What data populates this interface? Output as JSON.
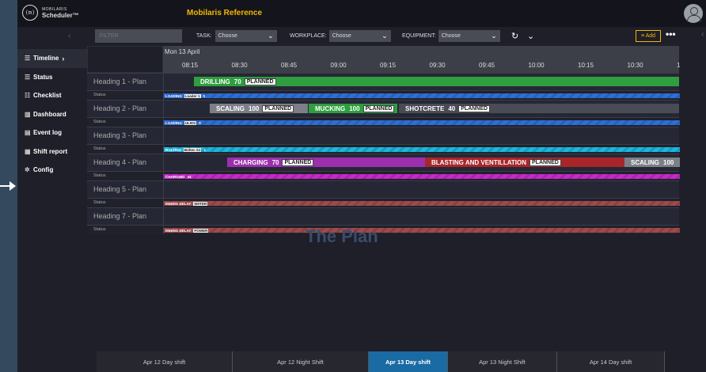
{
  "app": {
    "logo_line1": "MOBILARIS",
    "logo_line2": "Scheduler™",
    "logo_mark": "(m)",
    "title": "Mobilaris Reference"
  },
  "sidebar": {
    "items": [
      {
        "label": "Timeline",
        "icon": "timeline-icon",
        "glyph": "☰"
      },
      {
        "label": "Status",
        "icon": "list-icon",
        "glyph": "☰"
      },
      {
        "label": "Checklist",
        "icon": "checklist-icon",
        "glyph": "☷"
      },
      {
        "label": "Dashboard",
        "icon": "dashboard-icon",
        "glyph": "▥"
      },
      {
        "label": "Event log",
        "icon": "document-icon",
        "glyph": "▤"
      },
      {
        "label": "Shift report",
        "icon": "report-icon",
        "glyph": "▦"
      },
      {
        "label": "Config",
        "icon": "gear-icon",
        "glyph": "✲"
      }
    ]
  },
  "filters": {
    "filter_placeholder": "FILTER",
    "task_label": "TASK:",
    "task_value": "Choose",
    "workplace_label": "WORKPLACE:",
    "workplace_value": "Choose",
    "equipment_label": "EQUIPMENT:",
    "equipment_value": "Choose",
    "add_label": "≡ Add",
    "more_label": "•••"
  },
  "timeline": {
    "date": "Mon 13 April",
    "ticks": [
      "08:15",
      "08:30",
      "08:45",
      "09:00",
      "09:15",
      "09:30",
      "09:45",
      "10:00",
      "10:15",
      "10:30",
      "1"
    ]
  },
  "rows": [
    {
      "heading": "Heading 1 - Plan",
      "status_label": "Status",
      "bars": [
        {
          "name": "DRILLING",
          "value": "70",
          "state": "PLANNED",
          "color": "#2e9e3f"
        }
      ],
      "status": {
        "text": "LOADING",
        "tag": "Loader 1",
        "count": "0",
        "color": "#2d6fd8"
      }
    },
    {
      "heading": "Heading 2 - Plan",
      "status_label": "Status",
      "bars": [
        {
          "name": "SCALING",
          "value": "100",
          "state": "PLANNED",
          "color": "#7d7f87"
        },
        {
          "name": "MUCKING",
          "value": "100",
          "state": "PLANNED",
          "color": "#2e9e3f"
        },
        {
          "name": "SHOTCRETE",
          "value": "40",
          "state": "PLANNED",
          "color": "#4a4c55"
        }
      ],
      "status": {
        "text": "LOADING",
        "tag": "UL001",
        "count": "0",
        "color": "#2d6fd8"
      }
    },
    {
      "heading": "Heading 3 - Plan",
      "status_label": "Status",
      "bars": [],
      "status": {
        "text": "BOLTING",
        "tag": "Boltec S1",
        "count": "1",
        "color": "#19b8e0"
      }
    },
    {
      "heading": "Heading 4 - Plan",
      "status_label": "Status",
      "bars": [
        {
          "name": "CHARGING",
          "value": "70",
          "state": "PLANNED",
          "color": "#9b2fae"
        },
        {
          "name": "BLASTING AND VENTILLATION",
          "value": "",
          "state": "PLANNED",
          "color": "#a8262a"
        },
        {
          "name": "SCALING",
          "value": "100",
          "state": "",
          "color": "#7d7f87"
        }
      ],
      "status": {
        "text": "CHARGING",
        "tag": "",
        "count": "34",
        "color": "#c928c9"
      }
    },
    {
      "heading": "Heading 5 - Plan",
      "status_label": "Status",
      "bars": [],
      "status": {
        "text": "MINING DELAY",
        "tag": "WATER",
        "count": "",
        "color": "#a04a4a"
      }
    },
    {
      "heading": "Heading 7 - Plan",
      "status_label": "Status",
      "bars": [],
      "status": {
        "text": "MINING DELAY",
        "tag": "POWER",
        "count": "",
        "color": "#a04a4a"
      }
    }
  ],
  "watermark": "The Plan",
  "shifts": [
    "Apr 12 Day shift",
    "Apr 12 Night Shift",
    "Apr 13 Day shift",
    "Apr 13 Night Shift",
    "Apr 14 Day shift"
  ],
  "active_shift": "Apr 13 Day shift"
}
